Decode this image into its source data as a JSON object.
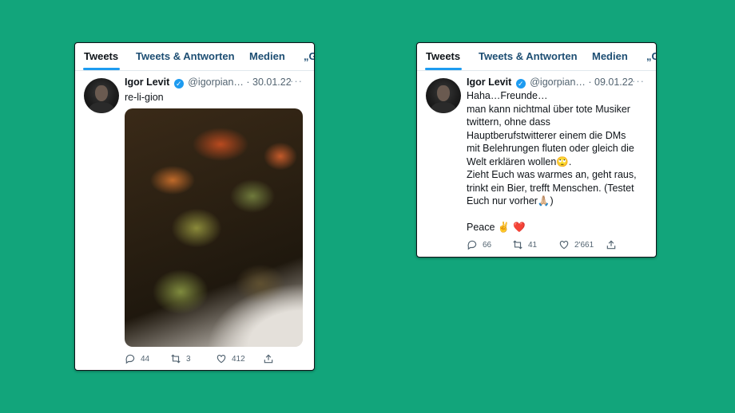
{
  "cards": [
    {
      "tabs": [
        "Tweets",
        "Tweets & Antworten",
        "Medien",
        "„G"
      ],
      "author": {
        "name": "Igor Levit",
        "handle": "@igorpian…",
        "date": "· 30.01.22"
      },
      "more": "···",
      "text_lines": [
        "re-li-gion"
      ],
      "has_photo": true,
      "actions": {
        "replies": "44",
        "retweets": "3",
        "likes": "412"
      }
    },
    {
      "tabs": [
        "Tweets",
        "Tweets & Antworten",
        "Medien",
        "„G"
      ],
      "author": {
        "name": "Igor Levit",
        "handle": "@igorpian…",
        "date": "· 09.01.22"
      },
      "more": "···",
      "text_lines": [
        "Haha…Freunde…",
        "man kann nichtmal über tote Musiker",
        "twittern, ohne dass",
        "Hauptberufstwitterer einem die DMs",
        "mit Belehrungen fluten oder gleich die",
        "Welt erklären wollen🙄.",
        "Zieht Euch was warmes an, geht raus,",
        "trinkt ein Bier, trefft Menschen. (Testet",
        "Euch nur vorher🙏🏼)",
        "",
        "Peace ✌️ ❤️"
      ],
      "has_photo": false,
      "actions": {
        "replies": "66",
        "retweets": "41",
        "likes": "2'661"
      }
    }
  ],
  "colors": {
    "background": "#12a57b",
    "accent": "#1d9bf0"
  }
}
